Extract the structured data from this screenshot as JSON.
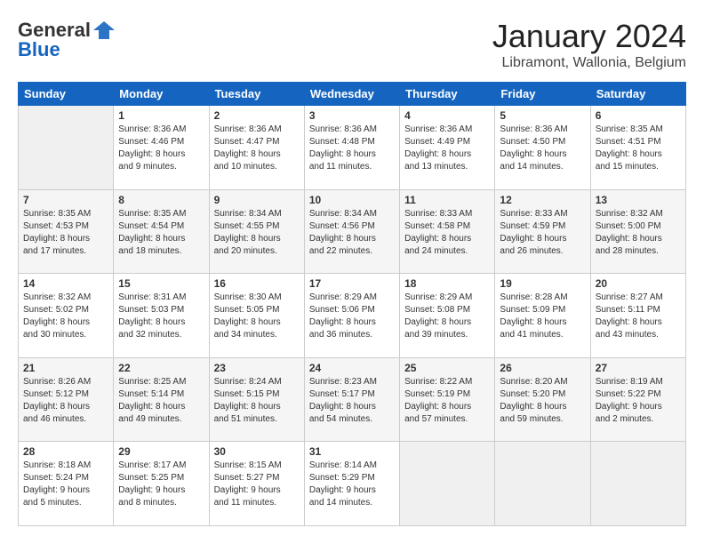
{
  "header": {
    "logo_general": "General",
    "logo_blue": "Blue",
    "month_title": "January 2024",
    "location": "Libramont, Wallonia, Belgium"
  },
  "weekdays": [
    "Sunday",
    "Monday",
    "Tuesday",
    "Wednesday",
    "Thursday",
    "Friday",
    "Saturday"
  ],
  "weeks": [
    [
      {
        "num": "",
        "info": ""
      },
      {
        "num": "1",
        "info": "Sunrise: 8:36 AM\nSunset: 4:46 PM\nDaylight: 8 hours\nand 9 minutes."
      },
      {
        "num": "2",
        "info": "Sunrise: 8:36 AM\nSunset: 4:47 PM\nDaylight: 8 hours\nand 10 minutes."
      },
      {
        "num": "3",
        "info": "Sunrise: 8:36 AM\nSunset: 4:48 PM\nDaylight: 8 hours\nand 11 minutes."
      },
      {
        "num": "4",
        "info": "Sunrise: 8:36 AM\nSunset: 4:49 PM\nDaylight: 8 hours\nand 13 minutes."
      },
      {
        "num": "5",
        "info": "Sunrise: 8:36 AM\nSunset: 4:50 PM\nDaylight: 8 hours\nand 14 minutes."
      },
      {
        "num": "6",
        "info": "Sunrise: 8:35 AM\nSunset: 4:51 PM\nDaylight: 8 hours\nand 15 minutes."
      }
    ],
    [
      {
        "num": "7",
        "info": "Sunrise: 8:35 AM\nSunset: 4:53 PM\nDaylight: 8 hours\nand 17 minutes."
      },
      {
        "num": "8",
        "info": "Sunrise: 8:35 AM\nSunset: 4:54 PM\nDaylight: 8 hours\nand 18 minutes."
      },
      {
        "num": "9",
        "info": "Sunrise: 8:34 AM\nSunset: 4:55 PM\nDaylight: 8 hours\nand 20 minutes."
      },
      {
        "num": "10",
        "info": "Sunrise: 8:34 AM\nSunset: 4:56 PM\nDaylight: 8 hours\nand 22 minutes."
      },
      {
        "num": "11",
        "info": "Sunrise: 8:33 AM\nSunset: 4:58 PM\nDaylight: 8 hours\nand 24 minutes."
      },
      {
        "num": "12",
        "info": "Sunrise: 8:33 AM\nSunset: 4:59 PM\nDaylight: 8 hours\nand 26 minutes."
      },
      {
        "num": "13",
        "info": "Sunrise: 8:32 AM\nSunset: 5:00 PM\nDaylight: 8 hours\nand 28 minutes."
      }
    ],
    [
      {
        "num": "14",
        "info": "Sunrise: 8:32 AM\nSunset: 5:02 PM\nDaylight: 8 hours\nand 30 minutes."
      },
      {
        "num": "15",
        "info": "Sunrise: 8:31 AM\nSunset: 5:03 PM\nDaylight: 8 hours\nand 32 minutes."
      },
      {
        "num": "16",
        "info": "Sunrise: 8:30 AM\nSunset: 5:05 PM\nDaylight: 8 hours\nand 34 minutes."
      },
      {
        "num": "17",
        "info": "Sunrise: 8:29 AM\nSunset: 5:06 PM\nDaylight: 8 hours\nand 36 minutes."
      },
      {
        "num": "18",
        "info": "Sunrise: 8:29 AM\nSunset: 5:08 PM\nDaylight: 8 hours\nand 39 minutes."
      },
      {
        "num": "19",
        "info": "Sunrise: 8:28 AM\nSunset: 5:09 PM\nDaylight: 8 hours\nand 41 minutes."
      },
      {
        "num": "20",
        "info": "Sunrise: 8:27 AM\nSunset: 5:11 PM\nDaylight: 8 hours\nand 43 minutes."
      }
    ],
    [
      {
        "num": "21",
        "info": "Sunrise: 8:26 AM\nSunset: 5:12 PM\nDaylight: 8 hours\nand 46 minutes."
      },
      {
        "num": "22",
        "info": "Sunrise: 8:25 AM\nSunset: 5:14 PM\nDaylight: 8 hours\nand 49 minutes."
      },
      {
        "num": "23",
        "info": "Sunrise: 8:24 AM\nSunset: 5:15 PM\nDaylight: 8 hours\nand 51 minutes."
      },
      {
        "num": "24",
        "info": "Sunrise: 8:23 AM\nSunset: 5:17 PM\nDaylight: 8 hours\nand 54 minutes."
      },
      {
        "num": "25",
        "info": "Sunrise: 8:22 AM\nSunset: 5:19 PM\nDaylight: 8 hours\nand 57 minutes."
      },
      {
        "num": "26",
        "info": "Sunrise: 8:20 AM\nSunset: 5:20 PM\nDaylight: 8 hours\nand 59 minutes."
      },
      {
        "num": "27",
        "info": "Sunrise: 8:19 AM\nSunset: 5:22 PM\nDaylight: 9 hours\nand 2 minutes."
      }
    ],
    [
      {
        "num": "28",
        "info": "Sunrise: 8:18 AM\nSunset: 5:24 PM\nDaylight: 9 hours\nand 5 minutes."
      },
      {
        "num": "29",
        "info": "Sunrise: 8:17 AM\nSunset: 5:25 PM\nDaylight: 9 hours\nand 8 minutes."
      },
      {
        "num": "30",
        "info": "Sunrise: 8:15 AM\nSunset: 5:27 PM\nDaylight: 9 hours\nand 11 minutes."
      },
      {
        "num": "31",
        "info": "Sunrise: 8:14 AM\nSunset: 5:29 PM\nDaylight: 9 hours\nand 14 minutes."
      },
      {
        "num": "",
        "info": ""
      },
      {
        "num": "",
        "info": ""
      },
      {
        "num": "",
        "info": ""
      }
    ]
  ]
}
